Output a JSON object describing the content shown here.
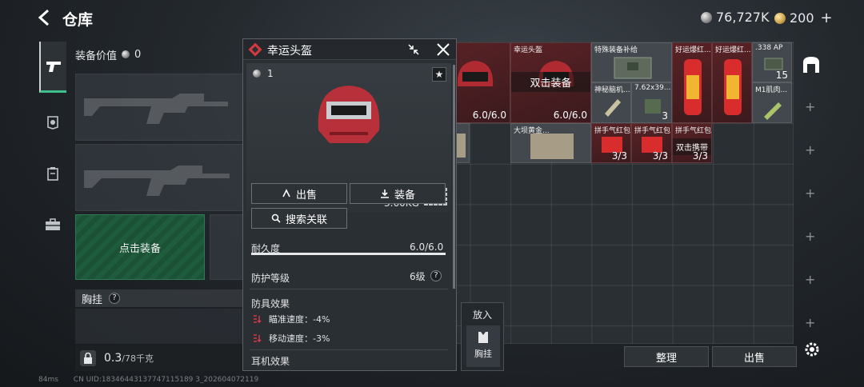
{
  "header": {
    "title": "仓库",
    "currency_silver": "76,727K",
    "currency_gold": "200"
  },
  "equipment": {
    "value_label": "装备价值",
    "value": "0",
    "click_equip_label": "点击装备",
    "vest_label": "胸挂",
    "weight_current": "0.3",
    "weight_max": "/78千克"
  },
  "popup": {
    "title": "幸运头盔",
    "quantity": "1",
    "weight": "3.60KG",
    "sell_label": "出售",
    "equip_label": "装备",
    "search_label": "搜索关联",
    "durability_label": "耐久度",
    "durability_value": "6.0/6.0",
    "durability_fraction": 1.0,
    "protection_label": "防护等级",
    "protection_value": "6级",
    "armor_effects_label": "防具效果",
    "effect_aim": "瞄准速度：-4%",
    "effect_move": "移动速度：-3%",
    "ear_effects_label": "耳机效果"
  },
  "inventory": {
    "items": [
      {
        "name": "",
        "value": "6.0/6.0"
      },
      {
        "name": "幸运头盔",
        "value": "6.0/6.0",
        "overlay": "双击装备"
      },
      {
        "name": "特殊装备补给",
        "value": ""
      },
      {
        "name": "好运爆红...",
        "value": ""
      },
      {
        "name": "好运爆红...",
        "value": ""
      },
      {
        "name": ".338 AP",
        "value": "15"
      },
      {
        "name": "神秘脑机...",
        "value": ""
      },
      {
        "name": "7.62x39... BP",
        "value": "3"
      },
      {
        "name": "M1肌肉...",
        "value": ""
      },
      {
        "name": "",
        "value": ""
      },
      {
        "name": "大坝黄金...",
        "value": ""
      },
      {
        "name": "拼手气红包",
        "value": "3/3"
      },
      {
        "name": "拼手气红包",
        "value": "3/3"
      },
      {
        "name": "拼手气红包",
        "value": "3/3",
        "overlay": "双击携带"
      }
    ],
    "put_in_label": "放入",
    "vest_slot_label": "胸挂",
    "organize_label": "整理",
    "sell_label": "出售"
  },
  "footer": {
    "ping": "84ms",
    "uid": "CN UID:18346443137747115189 3_202604072119"
  },
  "colors": {
    "accent_green": "#3fbf8c",
    "item_red": "#5a2226",
    "popup_logo": "#d8383f"
  },
  "icons": [
    "back-icon",
    "silver-coin-icon",
    "gold-coin-icon",
    "pistol-icon",
    "armor-icon",
    "backpack-icon",
    "case-icon",
    "shrink-icon",
    "close-icon",
    "star-icon",
    "lock-icon",
    "gear-icon",
    "vest-icon"
  ]
}
